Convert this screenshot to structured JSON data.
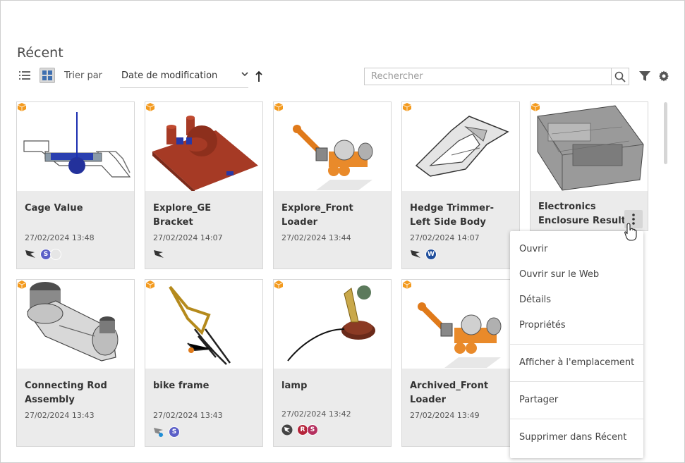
{
  "page": {
    "title": "Récent"
  },
  "toolbar": {
    "list_view_icon": "list-view-icon",
    "grid_view_icon": "grid-view-icon",
    "sort_label": "Trier par",
    "sort_value": "Date de modification",
    "sort_direction": "ascending",
    "search_placeholder": "Rechercher",
    "search_icon": "search-icon",
    "filter_icon": "filter-icon",
    "settings_icon": "gear-icon"
  },
  "colors": {
    "accent": "#f5a623",
    "selected_bg": "#d6d6d6",
    "card_bg": "#ebebeb"
  },
  "cards": [
    {
      "name_line1": "Cage Value",
      "name_line2": "",
      "date": "27/02/2024 13:48",
      "icons": [
        "flag-icon"
      ],
      "avatars": [
        {
          "letter": "S",
          "color": "#5b5fc7"
        },
        {
          "letter": "",
          "color": "#e6e6e6"
        }
      ]
    },
    {
      "name_line1": "Explore_GE",
      "name_line2": "Bracket",
      "date": "27/02/2024 14:07",
      "icons": [
        "flag-icon"
      ],
      "avatars": []
    },
    {
      "name_line1": "Explore_Front",
      "name_line2": "Loader",
      "date": "27/02/2024 13:44",
      "icons": [],
      "avatars": []
    },
    {
      "name_line1": "Hedge Trimmer-",
      "name_line2": "Left Side Body",
      "date": "27/02/2024 14:07",
      "icons": [
        "flag-icon"
      ],
      "avatars": [
        {
          "letter": "W",
          "color": "#1f4e9c"
        }
      ]
    },
    {
      "name_line1": "Electronics",
      "name_line2": "Enclosure Results",
      "date": "",
      "icons": [],
      "avatars": []
    },
    {
      "name_line1": "Connecting Rod",
      "name_line2": "Assembly",
      "date": "27/02/2024 13:43",
      "icons": [],
      "avatars": []
    },
    {
      "name_line1": "bike frame",
      "name_line2": "",
      "date": "27/02/2024 13:43",
      "icons": [
        "flag-info-icon"
      ],
      "avatars": [
        {
          "letter": "S",
          "color": "#5b5fc7"
        }
      ]
    },
    {
      "name_line1": "lamp",
      "name_line2": "",
      "date": "27/02/2024 13:42",
      "icons": [
        "flag-circle-icon"
      ],
      "avatars": [
        {
          "letter": "R",
          "color": "#b5243a"
        },
        {
          "letter": "S",
          "color": "#b5305f"
        }
      ]
    },
    {
      "name_line1": "Archived_Front",
      "name_line2": "Loader",
      "date": "27/02/2024 13:49",
      "icons": [],
      "avatars": []
    }
  ],
  "context_menu": {
    "items": [
      "Ouvrir",
      "Ouvrir sur le Web",
      "Détails",
      "Propriétés",
      "Afficher à l'emplacement",
      "Partager",
      "Supprimer dans Récent"
    ]
  }
}
